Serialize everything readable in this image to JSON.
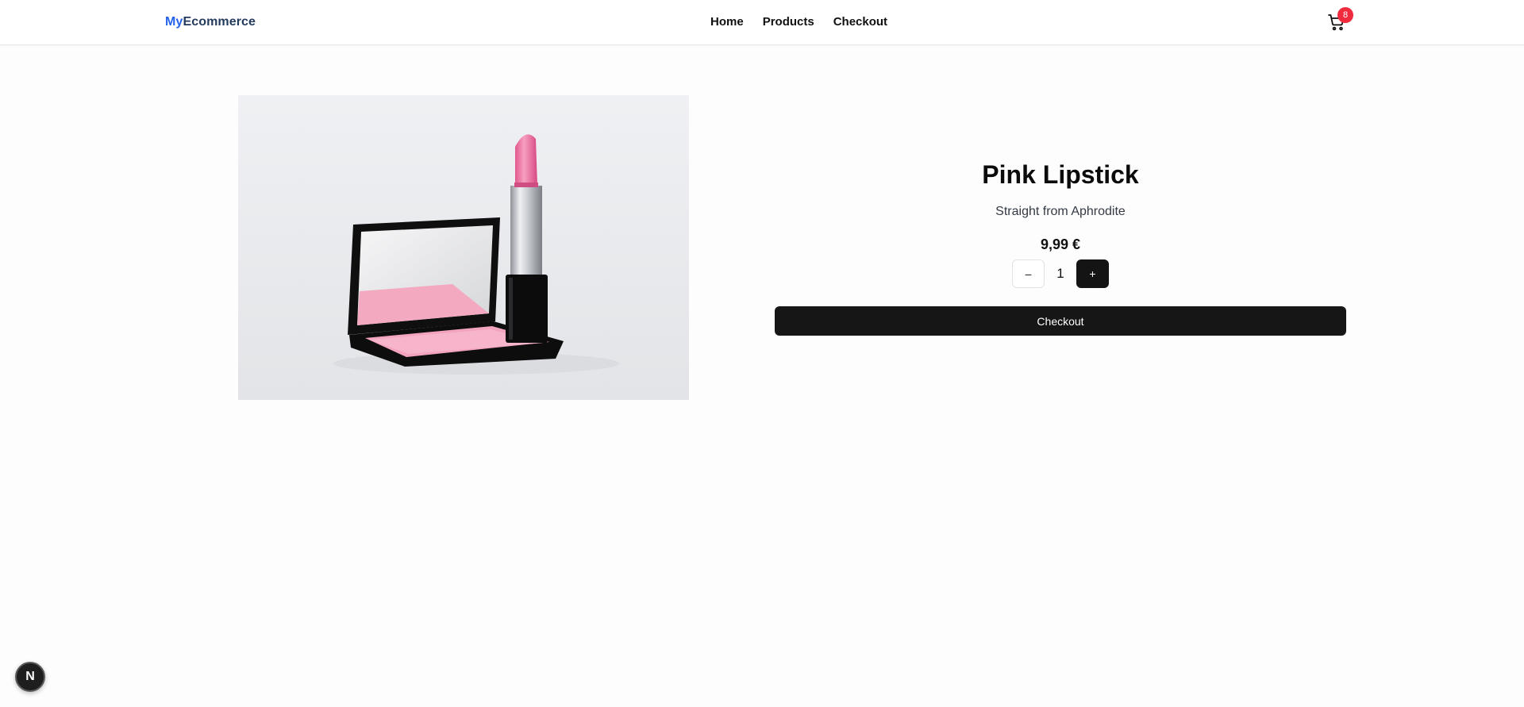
{
  "brand": {
    "part1": "My",
    "part2": "Ecommerce"
  },
  "nav": {
    "items": [
      {
        "label": "Home"
      },
      {
        "label": "Products"
      },
      {
        "label": "Checkout"
      }
    ]
  },
  "cart": {
    "icon": "cart-icon",
    "count": "8",
    "badge_color": "#ef2b3d"
  },
  "product": {
    "image_alt": "Pink lipstick and compact blush",
    "title": "Pink Lipstick",
    "description": "Straight from Aphrodite",
    "price": "9,99 €",
    "quantity": "1",
    "minus_label": "–",
    "plus_label": "+",
    "checkout_label": "Checkout"
  },
  "dev_badge": {
    "label": "N"
  },
  "colors": {
    "brand_primary": "#2563eb",
    "brand_secondary": "#243b5e",
    "button_dark": "#161616"
  }
}
